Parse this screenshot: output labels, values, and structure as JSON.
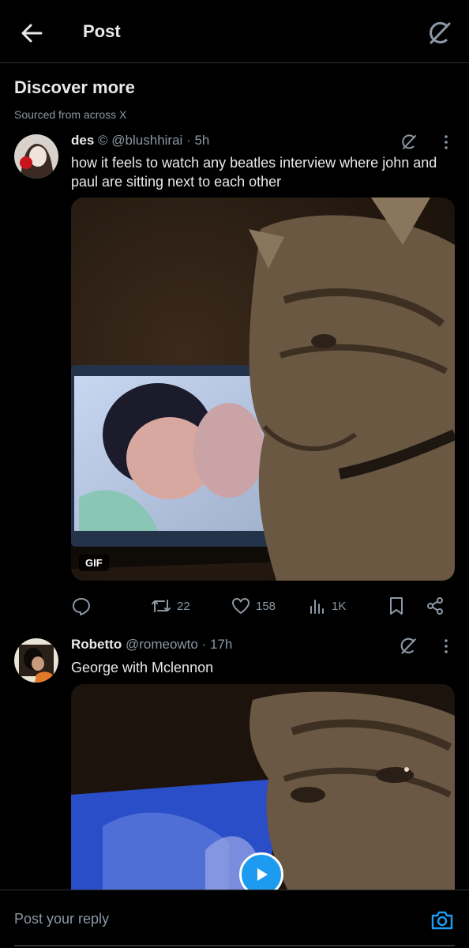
{
  "header": {
    "title": "Post",
    "back_icon": "arrow-left-icon",
    "grok_icon": "grok-icon"
  },
  "discover": {
    "title": "Discover more",
    "subtitle": "Sourced from across X"
  },
  "posts": [
    {
      "name": "des",
      "name_emoji": "©",
      "handle": "@blushhirai",
      "time": "5h",
      "text": "how it feels to watch any beatles interview where john and paul are sitting next to each other",
      "media_badge": "GIF",
      "replies": "",
      "reposts": "22",
      "likes": "158",
      "views": "1K"
    },
    {
      "name": "Robetto",
      "handle": "@romeowto",
      "time": "17h",
      "text": "George with Mclennon"
    }
  ],
  "composer": {
    "placeholder": "Post your reply",
    "camera_icon": "camera-icon"
  },
  "colors": {
    "background": "#000000",
    "text": "#e7e9ea",
    "muted": "#8b98a5",
    "accent": "#1d9bf0"
  }
}
